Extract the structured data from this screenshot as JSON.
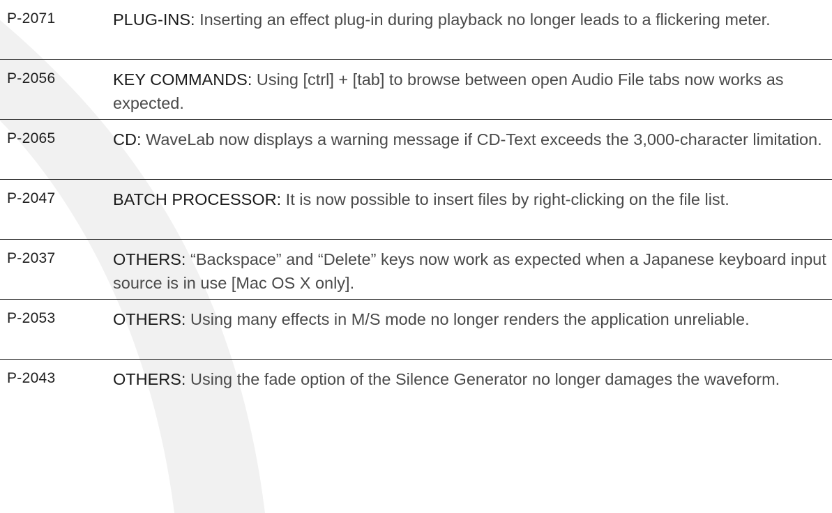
{
  "items": [
    {
      "id": "P-2071",
      "category": "PLUG-INS:",
      "description": "Inserting an effect plug-in during playback no longer leads to a flickering meter."
    },
    {
      "id": "P-2056",
      "category": "KEY COMMANDS:",
      "description": "Using [ctrl] + [tab] to browse between open Audio File tabs now works as expected."
    },
    {
      "id": "P-2065",
      "category": "CD:",
      "description": "WaveLab now displays a warning message if CD-Text exceeds the 3,000-character limitation."
    },
    {
      "id": "P-2047",
      "category": "BATCH PROCESSOR:",
      "description": "It is now possible to insert files by right-clicking on the file list."
    },
    {
      "id": "P-2037",
      "category": "OTHERS:",
      "description": "“Backspace” and “Delete” keys now work as expected when a Japanese keyboard input source is in use [Mac OS X only]."
    },
    {
      "id": "P-2053",
      "category": "OTHERS:",
      "description": "Using many effects in M/S mode no longer renders the application unreliable."
    },
    {
      "id": "P-2043",
      "category": "OTHERS:",
      "description": "Using the fade option of the Silence Generator no longer damages the waveform."
    }
  ]
}
